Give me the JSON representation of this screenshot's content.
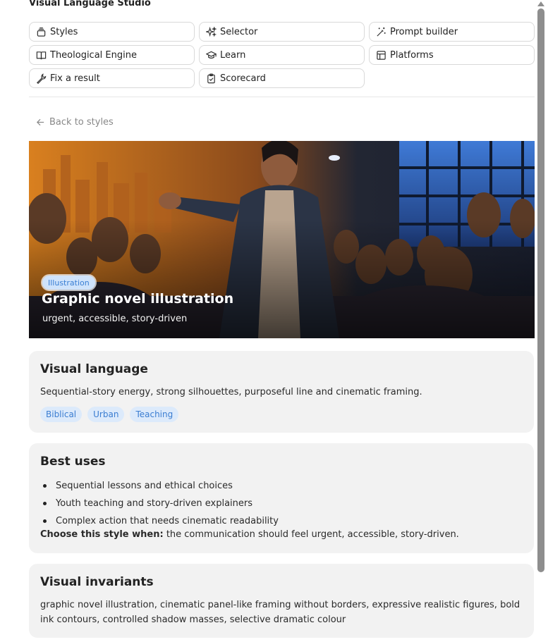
{
  "app": {
    "title": "Visual Language Studio"
  },
  "nav": [
    {
      "label": "Styles",
      "icon": "stack-icon"
    },
    {
      "label": "Selector",
      "icon": "sparkles-icon"
    },
    {
      "label": "Prompt builder",
      "icon": "magic-wand-icon"
    },
    {
      "label": "Theological Engine",
      "icon": "book-icon"
    },
    {
      "label": "Learn",
      "icon": "graduation-cap-icon"
    },
    {
      "label": "Platforms",
      "icon": "layout-icon"
    },
    {
      "label": "Fix a result",
      "icon": "wrench-icon"
    },
    {
      "label": "Scorecard",
      "icon": "clipboard-check-icon"
    }
  ],
  "back": {
    "label": "Back to styles"
  },
  "hero": {
    "badge": "Illustration",
    "title": "Graphic novel illustration",
    "subtitle": "urgent, accessible, story-driven"
  },
  "visual_language": {
    "heading": "Visual language",
    "text": "Sequential-story energy, strong silhouettes, purposeful line and cinematic framing.",
    "tags": [
      "Biblical",
      "Urban",
      "Teaching"
    ]
  },
  "best_uses": {
    "heading": "Best uses",
    "items": [
      "Sequential lessons and ethical choices",
      "Youth teaching and story-driven explainers",
      "Complex action that needs cinematic readability"
    ],
    "when_label": "Choose this style when:",
    "when_text": " the communication should feel urgent, accessible, story-driven."
  },
  "invariants": {
    "heading": "Visual invariants",
    "text": "graphic novel illustration, cinematic panel-like framing without borders, expressive realistic figures, bold ink contours, controlled shadow masses, selective dramatic colour"
  },
  "colors": {
    "accent": "#3b7dd1",
    "chip_bg": "#dceafb",
    "card_bg": "#f2f2f2"
  }
}
